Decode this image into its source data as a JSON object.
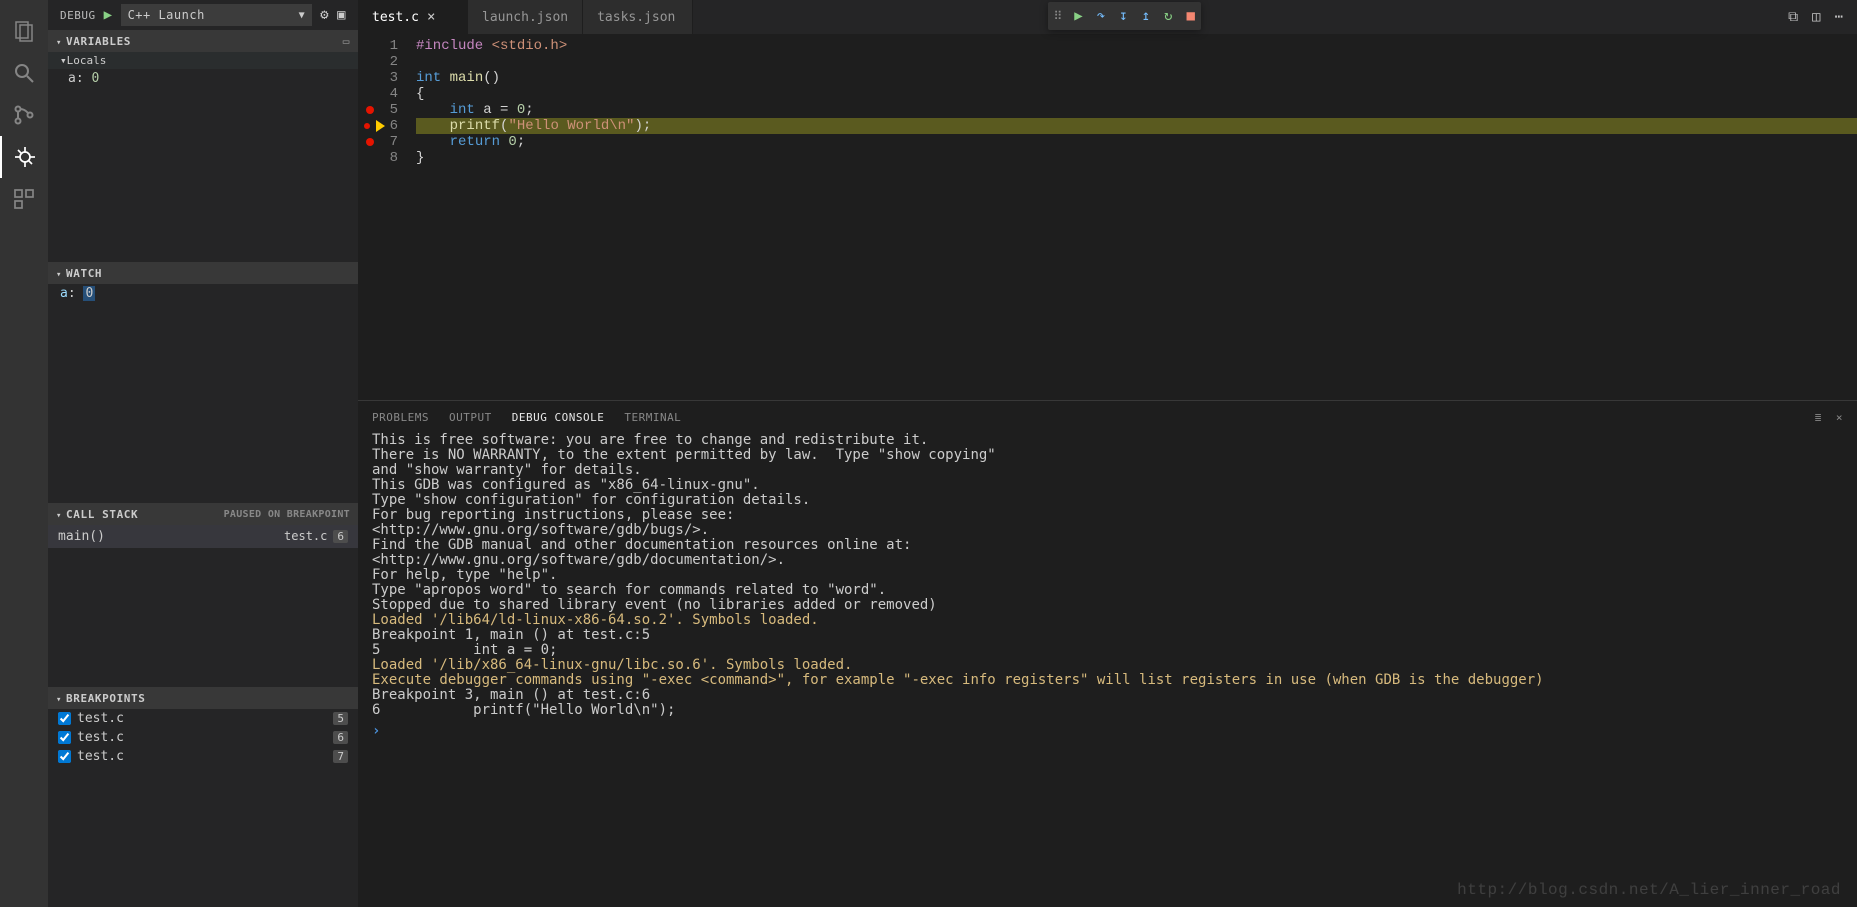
{
  "sidebar": {
    "title": "DEBUG",
    "config_label": "C++ Launch",
    "sections": {
      "variables": {
        "title": "VARIABLES",
        "scope": "Locals",
        "vars": [
          {
            "name": "a",
            "value": "0"
          }
        ]
      },
      "watch": {
        "title": "WATCH",
        "items": [
          {
            "name": "a",
            "value": "0"
          }
        ]
      },
      "callstack": {
        "title": "CALL STACK",
        "status": "PAUSED ON BREAKPOINT",
        "frames": [
          {
            "fn": "main()",
            "file": "test.c",
            "line": "6"
          }
        ]
      },
      "breakpoints": {
        "title": "BREAKPOINTS",
        "items": [
          {
            "file": "test.c",
            "line": "5"
          },
          {
            "file": "test.c",
            "line": "6"
          },
          {
            "file": "test.c",
            "line": "7"
          }
        ]
      }
    }
  },
  "tabs": [
    {
      "name": "test.c",
      "active": true,
      "closable": true
    },
    {
      "name": "launch.json",
      "active": false
    },
    {
      "name": "tasks.json",
      "active": false
    }
  ],
  "editor": {
    "lines": [
      {
        "n": "1"
      },
      {
        "n": "2"
      },
      {
        "n": "3"
      },
      {
        "n": "4"
      },
      {
        "n": "5",
        "bp": true
      },
      {
        "n": "6",
        "bp": true,
        "current": true
      },
      {
        "n": "7",
        "bp": true
      },
      {
        "n": "8"
      }
    ],
    "code": {
      "l1_a": "#include ",
      "l1_b": "<stdio.h>",
      "l3_a": "int ",
      "l3_b": "main",
      "l3_c": "()",
      "l4": "{",
      "l5_a": "    ",
      "l5_b": "int ",
      "l5_c": "a ",
      "l5_d": "= ",
      "l5_e": "0",
      "l5_f": ";",
      "l6_a": "    ",
      "l6_b": "printf",
      "l6_c": "(",
      "l6_d": "\"Hello World\\n\"",
      "l6_e": ");",
      "l7_a": "    ",
      "l7_b": "return ",
      "l7_c": "0",
      "l7_d": ";",
      "l8": "}"
    }
  },
  "panel": {
    "tabs": [
      "PROBLEMS",
      "OUTPUT",
      "DEBUG CONSOLE",
      "TERMINAL"
    ],
    "active": "DEBUG CONSOLE",
    "console_lines": [
      {
        "t": "This is free software: you are free to change and redistribute it."
      },
      {
        "t": "There is NO WARRANTY, to the extent permitted by law.  Type \"show copying\""
      },
      {
        "t": "and \"show warranty\" for details."
      },
      {
        "t": "This GDB was configured as \"x86_64-linux-gnu\"."
      },
      {
        "t": "Type \"show configuration\" for configuration details."
      },
      {
        "t": "For bug reporting instructions, please see:"
      },
      {
        "t": "<http://www.gnu.org/software/gdb/bugs/>."
      },
      {
        "t": "Find the GDB manual and other documentation resources online at:"
      },
      {
        "t": "<http://www.gnu.org/software/gdb/documentation/>."
      },
      {
        "t": "For help, type \"help\"."
      },
      {
        "t": "Type \"apropos word\" to search for commands related to \"word\"."
      },
      {
        "t": "Stopped due to shared library event (no libraries added or removed)"
      },
      {
        "t": "Loaded '/lib64/ld-linux-x86-64.so.2'. Symbols loaded.",
        "cls": "warn"
      },
      {
        "t": ""
      },
      {
        "t": "Breakpoint 1, main () at test.c:5"
      },
      {
        "t": "5           int a = 0;"
      },
      {
        "t": "Loaded '/lib/x86_64-linux-gnu/libc.so.6'. Symbols loaded.",
        "cls": "warn"
      },
      {
        "t": "Execute debugger commands using \"-exec <command>\", for example \"-exec info registers\" will list registers in use (when GDB is the debugger)",
        "cls": "warn"
      },
      {
        "t": ""
      },
      {
        "t": "Breakpoint 3, main () at test.c:6"
      },
      {
        "t": "6           printf(\"Hello World\\n\");"
      }
    ],
    "prompt": "›"
  },
  "watermark": "http://blog.csdn.net/A_lier_inner_road"
}
